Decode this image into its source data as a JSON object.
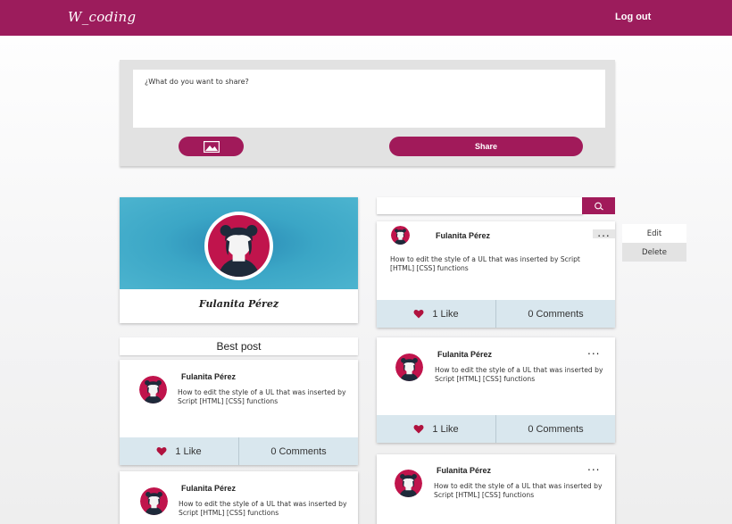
{
  "app": {
    "logo": "W_coding",
    "logout_label": "Log out"
  },
  "composer": {
    "placeholder": "¿What do you want to share?",
    "image_button_icon": "image-icon",
    "share_label": "Share"
  },
  "profile": {
    "name": "Fulanita Pérez",
    "avatar_icon": "user-avatar"
  },
  "best_post": {
    "title": "Best post",
    "posts": [
      {
        "author": "Fulanita Pérez",
        "text": "How to edit the style of a UL that was inserted by Script [HTML] [CSS] functions",
        "likes": "1 Like",
        "comments": "0 Comments"
      },
      {
        "author": "Fulanita Pérez",
        "text": "How to edit the style of a UL that was inserted by Script [HTML] [CSS] functions"
      }
    ]
  },
  "search": {
    "icon": "search-icon",
    "placeholder": ""
  },
  "feed": [
    {
      "author": "Fulanita Pérez",
      "text": "How to edit the style of a UL that was inserted by Script [HTML] [CSS] functions",
      "likes": "1 Like",
      "comments": "0 Comments",
      "more": "..."
    },
    {
      "author": "Fulanita Pérez",
      "text": "How to edit the style of a UL that was inserted by Script [HTML] [CSS] functions",
      "likes": "1 Like",
      "comments": "0 Comments",
      "more": "..."
    },
    {
      "author": "Fulanita Pérez",
      "text": "How to edit the style of a UL that was inserted by Script [HTML] [CSS] functions",
      "more": "..."
    }
  ],
  "post_menu": {
    "edit_label": "Edit",
    "delete_label": "Delete"
  },
  "colors": {
    "brand": "#9c1c5c",
    "button": "#a11a5a",
    "footer": "#d9e7ee",
    "heart": "#b0123e"
  }
}
